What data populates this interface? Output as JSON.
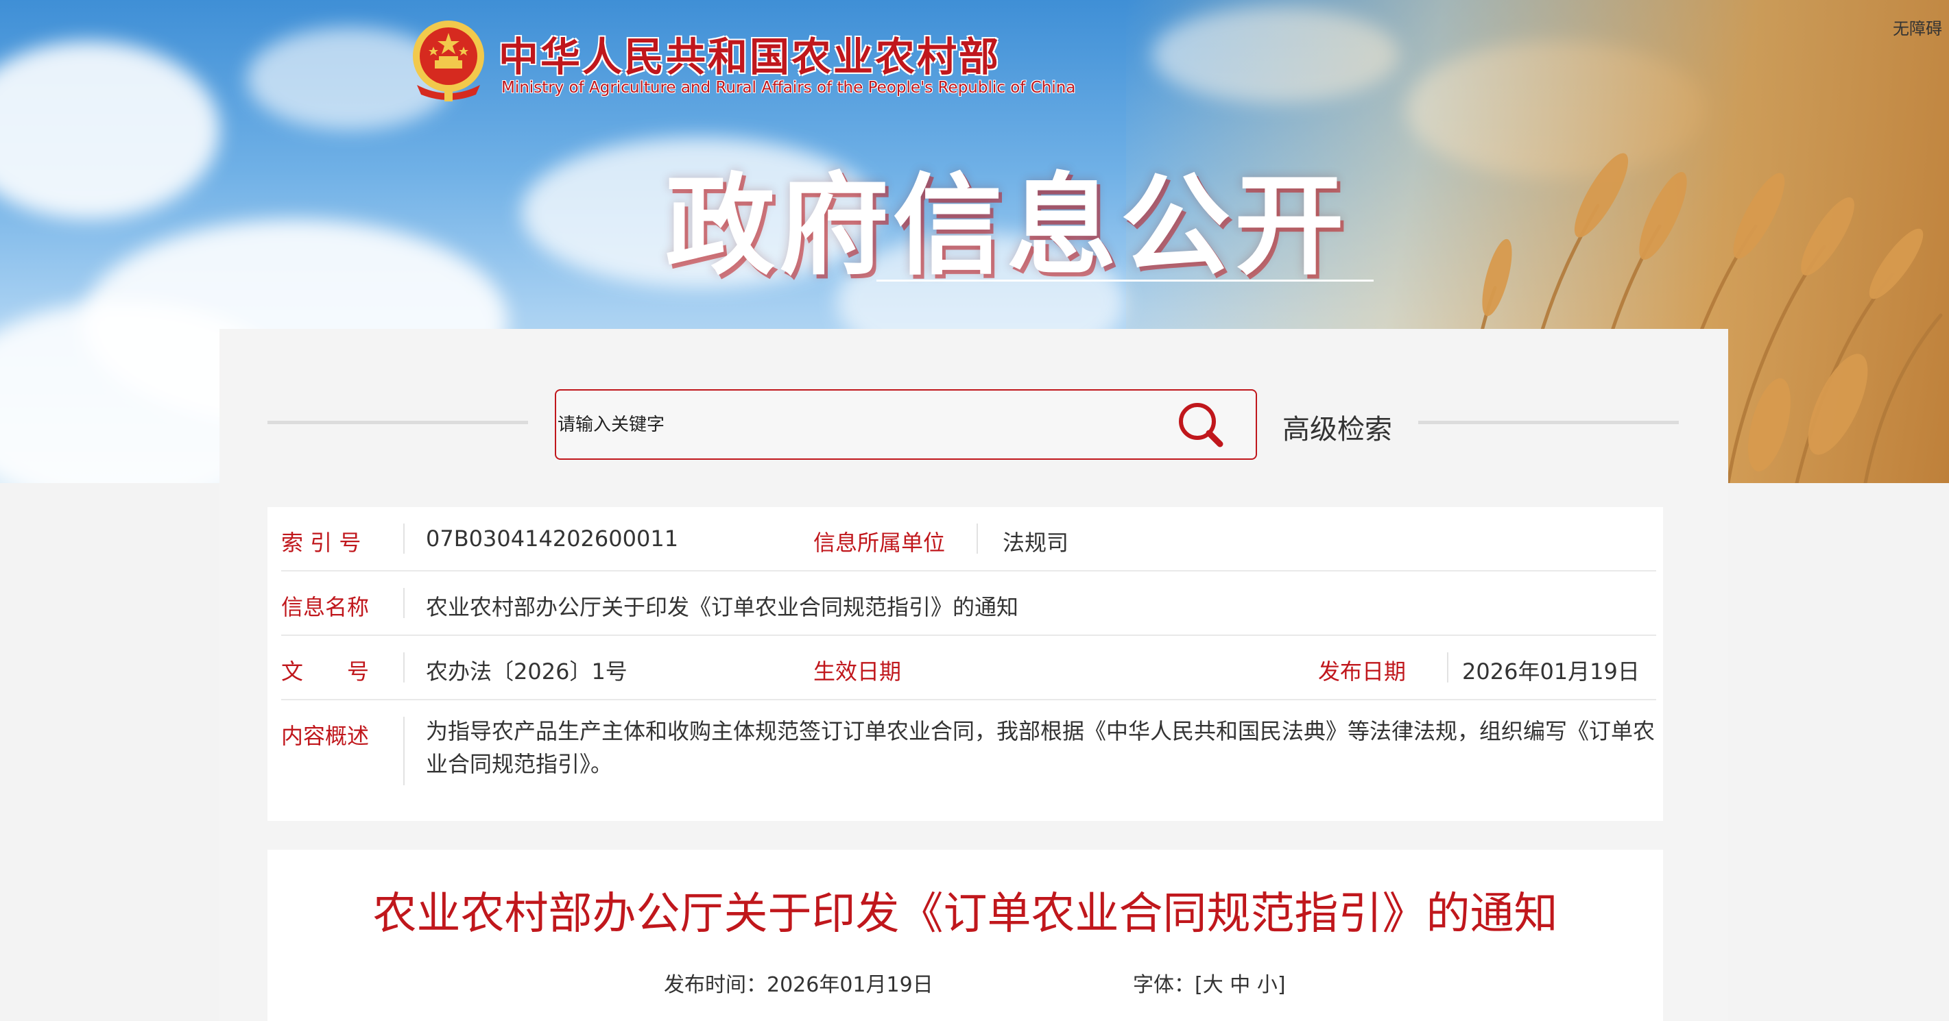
{
  "header": {
    "accessibility_label": "无障碍",
    "ministry_name_cn": "中华人民共和国农业农村部",
    "ministry_name_en": "Ministry of Agriculture and Rural Affairs of the People's Republic of China",
    "section_title": "政府信息公开",
    "emblem_icon": "national-emblem-icon"
  },
  "search": {
    "placeholder": "请输入关键字",
    "value": "",
    "icon": "search-icon",
    "advanced_label": "高级检索"
  },
  "meta": {
    "index_label": "索 引 号",
    "index_value": "07B030414202600011",
    "unit_label": "信息所属单位",
    "unit_value": "法规司",
    "name_label": "信息名称",
    "name_value": "农业农村部办公厅关于印发《订单农业合同规范指引》的通知",
    "docno_label": "文　　号",
    "docno_value": "农办法〔2026〕1号",
    "effective_label": "生效日期",
    "effective_value": "",
    "publish_label": "发布日期",
    "publish_value": "2026年01月19日",
    "summary_label": "内容概述",
    "summary_value": "为指导农产品生产主体和收购主体规范签订订单农业合同，我部根据《中华人民共和国民法典》等法律法规，组织编写《订单农业合同规范指引》。"
  },
  "article": {
    "title": "农业农村部办公厅关于印发《订单农业合同规范指引》的通知",
    "publish_time_label": "发布时间：",
    "publish_time_value": "2026年01月19日",
    "font_label": "字体：",
    "font_open": "[",
    "font_large": "大",
    "font_medium": "中",
    "font_small": "小",
    "font_close": "]"
  },
  "colors": {
    "accent_red": "#c0171c",
    "text": "#333333",
    "panel_bg": "#f4f4f4"
  }
}
